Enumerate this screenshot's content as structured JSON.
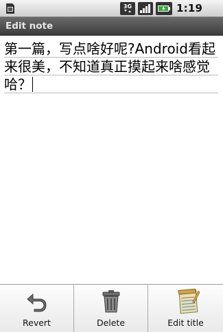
{
  "status_bar": {
    "network_type": "3G",
    "time": "1:19 PM",
    "icons": [
      "sim-card-icon",
      "data-activity-icon",
      "signal-icon",
      "battery-charging-icon"
    ]
  },
  "title_bar": {
    "title": "Edit note"
  },
  "editor": {
    "text": "第一篇，写点啥好呢?Android看起来很美，不知道真正摸起来啥感觉哈？"
  },
  "options_menu": {
    "items": [
      {
        "label": "Revert",
        "icon": "revert-arrow-icon"
      },
      {
        "label": "Delete",
        "icon": "trash-can-icon"
      },
      {
        "label": "Edit title",
        "icon": "notepad-icon"
      }
    ]
  },
  "colors": {
    "title_bar": "#4f4f4f",
    "status_bar": "#e0e0e0",
    "background": "#ffffff",
    "text": "#000000"
  }
}
